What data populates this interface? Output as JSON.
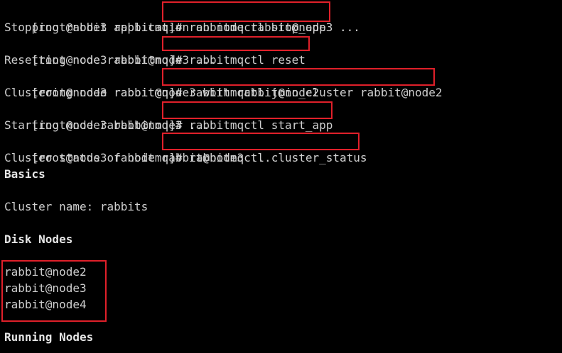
{
  "prompt": "[root@node3 rabbitmq]#",
  "commands": [
    "rabbitmqctl stop_app",
    "rabbitmqctl reset",
    "rabbitmqctl join_cluster rabbit@node2",
    "rabbitmqctl start_app",
    "rabbitmqctl cluster_status"
  ],
  "outputs": [
    "Stopping rabbit application on node rabbit@node3 ...",
    "Resetting node rabbit@node3 ...",
    "Clustering node rabbit@node3 with rabbit@node2",
    "Starting node rabbit@node3 ...",
    "Cluster status of node rabbit@node3 ..."
  ],
  "status": {
    "basics_heading": "Basics",
    "cluster_name_line": "Cluster name: rabbits",
    "disk_nodes_heading": "Disk Nodes",
    "disk_nodes": [
      "rabbit@node2",
      "rabbit@node3",
      "rabbit@node4"
    ],
    "running_nodes_heading": "Running Nodes"
  },
  "colors": {
    "background": "#000000",
    "text": "#cfcfcf",
    "highlight_box": "#e0202a"
  }
}
